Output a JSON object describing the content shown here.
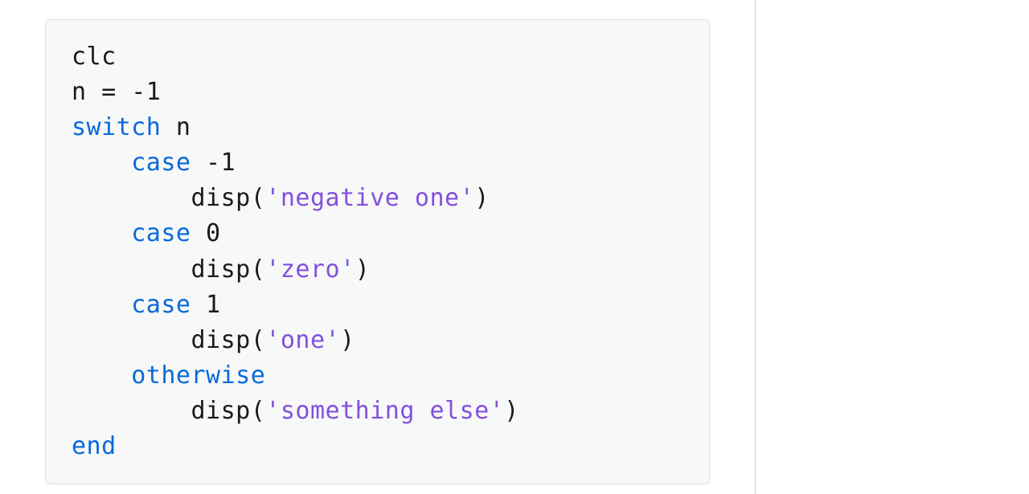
{
  "code": {
    "lines": [
      [
        {
          "t": "clc",
          "cls": ""
        }
      ],
      [
        {
          "t": "n = -1",
          "cls": ""
        }
      ],
      [
        {
          "t": "switch",
          "cls": "kw"
        },
        {
          "t": " n",
          "cls": ""
        }
      ],
      [
        {
          "t": "    ",
          "cls": ""
        },
        {
          "t": "case",
          "cls": "kw"
        },
        {
          "t": " -1",
          "cls": ""
        }
      ],
      [
        {
          "t": "        disp(",
          "cls": ""
        },
        {
          "t": "'negative one'",
          "cls": "str"
        },
        {
          "t": ")",
          "cls": ""
        }
      ],
      [
        {
          "t": "    ",
          "cls": ""
        },
        {
          "t": "case",
          "cls": "kw"
        },
        {
          "t": " 0",
          "cls": ""
        }
      ],
      [
        {
          "t": "        disp(",
          "cls": ""
        },
        {
          "t": "'zero'",
          "cls": "str"
        },
        {
          "t": ")",
          "cls": ""
        }
      ],
      [
        {
          "t": "    ",
          "cls": ""
        },
        {
          "t": "case",
          "cls": "kw"
        },
        {
          "t": " 1",
          "cls": ""
        }
      ],
      [
        {
          "t": "        disp(",
          "cls": ""
        },
        {
          "t": "'one'",
          "cls": "str"
        },
        {
          "t": ")",
          "cls": ""
        }
      ],
      [
        {
          "t": "    ",
          "cls": ""
        },
        {
          "t": "otherwise",
          "cls": "kw"
        }
      ],
      [
        {
          "t": "        disp(",
          "cls": ""
        },
        {
          "t": "'something else'",
          "cls": "str"
        },
        {
          "t": ")",
          "cls": ""
        }
      ],
      [
        {
          "t": "end",
          "cls": "kw"
        }
      ]
    ]
  }
}
